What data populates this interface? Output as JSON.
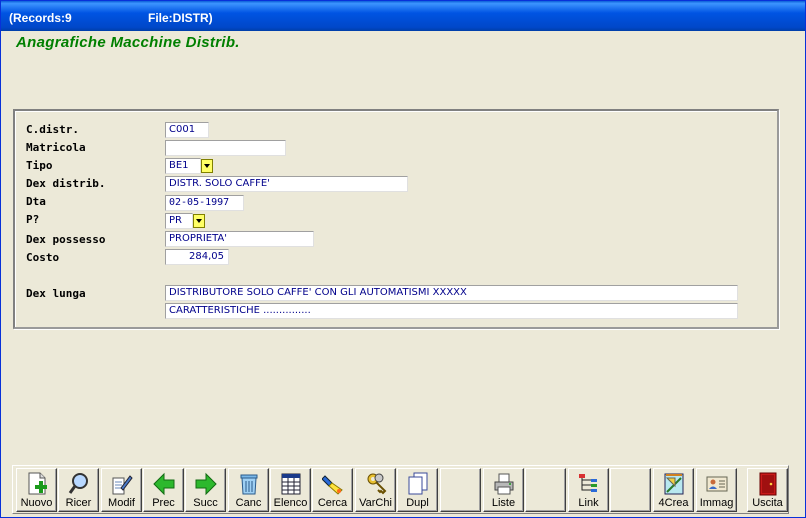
{
  "titlebar": {
    "records": "(Records:9",
    "file": "File:DISTR)"
  },
  "form": {
    "title": "Anagrafiche Macchine Distrib.",
    "fields": {
      "c_distr": {
        "label": "C.distr.",
        "value": "C001"
      },
      "matricola": {
        "label": "Matricola",
        "value": ""
      },
      "tipo": {
        "label": "Tipo",
        "value": "BE1"
      },
      "dex_distrib": {
        "label": "Dex distrib.",
        "value": "DISTR. SOLO CAFFE'"
      },
      "dta": {
        "label": "Dta",
        "value": "02-05-1997"
      },
      "p": {
        "label": "P?",
        "value": "PR"
      },
      "dex_possesso": {
        "label": "Dex possesso",
        "value": "PROPRIETA'"
      },
      "costo": {
        "label": "Costo",
        "value": "284,05"
      },
      "dex_lunga": {
        "label": "Dex lunga",
        "line1": "DISTRIBUTORE SOLO CAFFE' CON GLI AUTOMATISMI  XXXXX",
        "line2": "CARATTERISTICHE ..............."
      }
    }
  },
  "toolbar": {
    "buttons": [
      {
        "label": "Nuovo",
        "icon": "new-document-plus-icon"
      },
      {
        "label": "Ricer",
        "icon": "magnifier-icon"
      },
      {
        "label": "Modif",
        "icon": "edit-document-icon"
      },
      {
        "label": "Prec",
        "icon": "green-arrow-left-icon"
      },
      {
        "label": "Succ",
        "icon": "green-arrow-right-icon"
      },
      {
        "label": "Canc",
        "icon": "trash-can-icon"
      },
      {
        "label": "Elenco",
        "icon": "table-list-icon"
      },
      {
        "label": "Cerca",
        "icon": "flashlight-icon"
      },
      {
        "label": "VarChi",
        "icon": "keys-icon"
      },
      {
        "label": "Dupl",
        "icon": "duplicate-pages-icon"
      },
      {
        "label": "",
        "icon": ""
      },
      {
        "label": "Liste",
        "icon": "printer-icon"
      },
      {
        "label": "",
        "icon": ""
      },
      {
        "label": "Link",
        "icon": "tree-link-icon"
      },
      {
        "label": "",
        "icon": ""
      },
      {
        "label": "4Crea",
        "icon": "design-tools-icon"
      },
      {
        "label": "Immag",
        "icon": "id-card-icon"
      },
      {
        "label": "",
        "icon": ""
      },
      {
        "label": "Uscita",
        "icon": "exit-door-icon"
      }
    ]
  },
  "colors": {
    "title_green": "#008000",
    "titlebar_blue": "#0054e3",
    "field_text": "#00008b",
    "dropdown_yellow": "#ffff66"
  }
}
